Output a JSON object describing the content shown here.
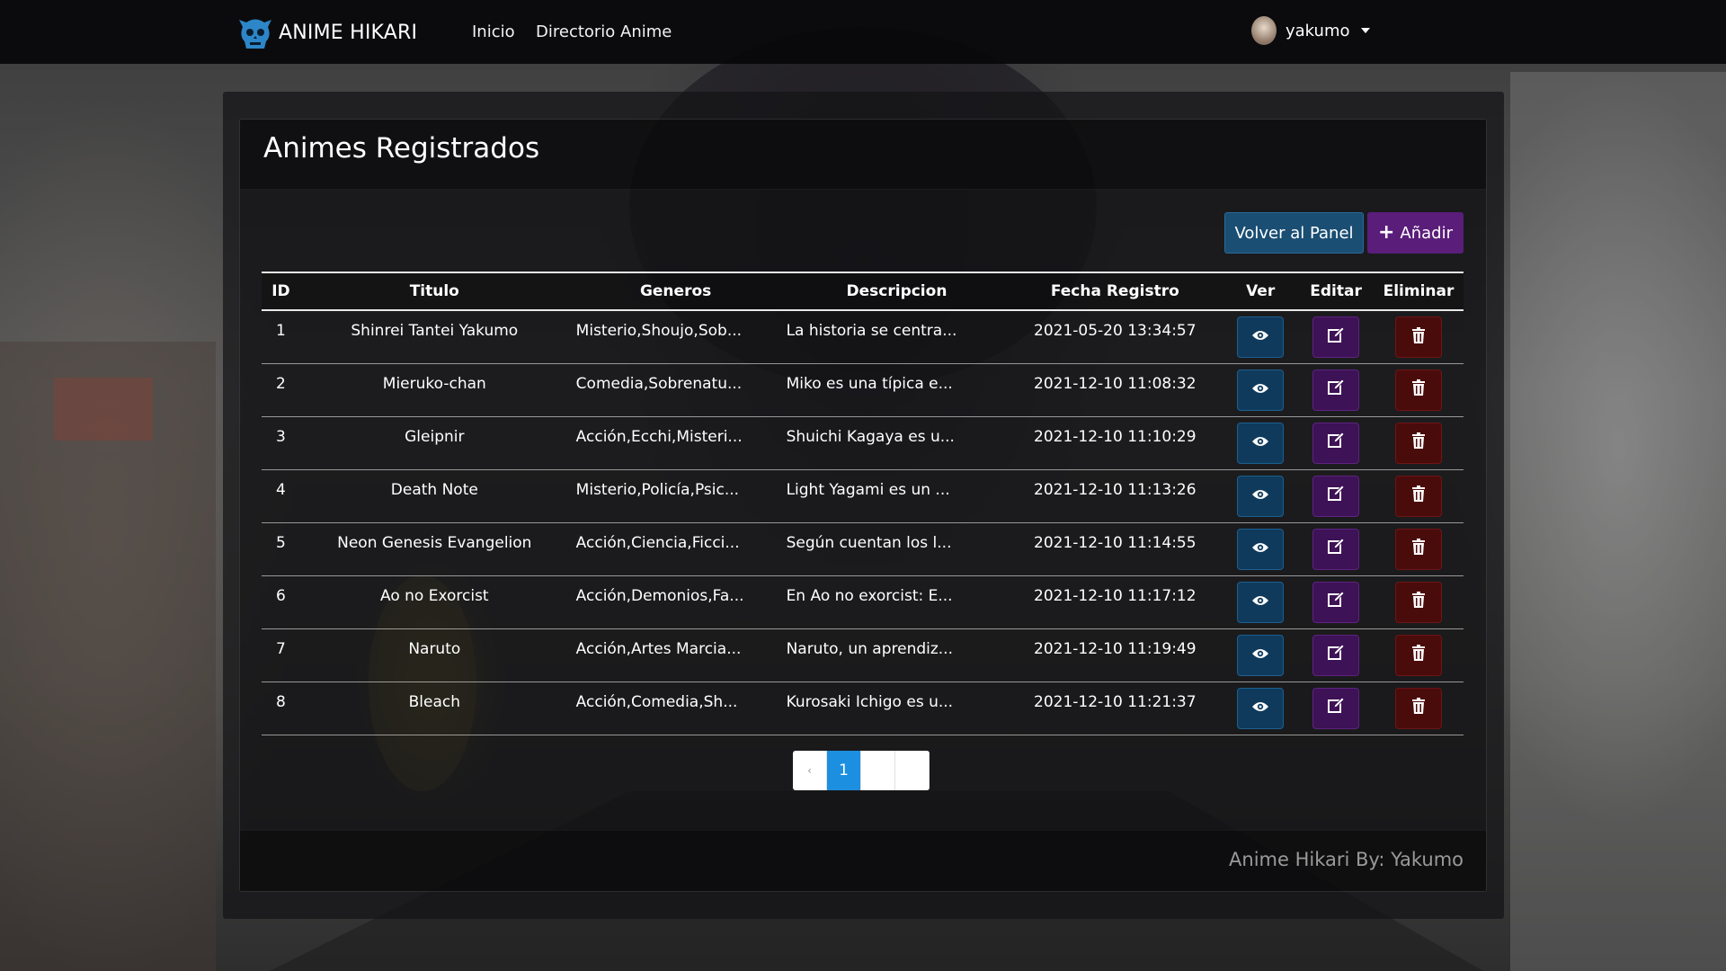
{
  "nav": {
    "brand": "ANIME HIKARI",
    "links": [
      "Inicio",
      "Directorio Anime"
    ],
    "user": "yakumo"
  },
  "card": {
    "title": "Animes Registrados",
    "back_button": "Volver al Panel",
    "add_button": "Añadir",
    "footer": "Anime Hikari By: Yakumo"
  },
  "table": {
    "headers": [
      "ID",
      "Titulo",
      "Generos",
      "Descripcion",
      "Fecha Registro",
      "Ver",
      "Editar",
      "Eliminar"
    ],
    "rows": [
      {
        "id": "1",
        "title": "Shinrei Tantei Yakumo",
        "genres": "Misterio,Shoujo,Sob...",
        "desc": "La historia se centra...",
        "date": "2021-05-20 13:34:57"
      },
      {
        "id": "2",
        "title": "Mieruko-chan",
        "genres": "Comedia,Sobrenatu...",
        "desc": "Miko es una típica e...",
        "date": "2021-12-10 11:08:32"
      },
      {
        "id": "3",
        "title": "Gleipnir",
        "genres": "Acción,Ecchi,Misteri...",
        "desc": "Shuichi Kagaya es u...",
        "date": "2021-12-10 11:10:29"
      },
      {
        "id": "4",
        "title": "Death Note",
        "genres": "Misterio,Policía,Psic...",
        "desc": "Light Yagami es un ...",
        "date": "2021-12-10 11:13:26"
      },
      {
        "id": "5",
        "title": "Neon Genesis Evangelion",
        "genres": "Acción,Ciencia,Ficci...",
        "desc": "Según cuentan los l...",
        "date": "2021-12-10 11:14:55"
      },
      {
        "id": "6",
        "title": "Ao no Exorcist",
        "genres": "Acción,Demonios,Fa...",
        "desc": "En Ao no exorcist: E...",
        "date": "2021-12-10 11:17:12"
      },
      {
        "id": "7",
        "title": "Naruto",
        "genres": "Acción,Artes Marcia...",
        "desc": "Naruto, un aprendiz...",
        "date": "2021-12-10 11:19:49"
      },
      {
        "id": "8",
        "title": "Bleach",
        "genres": "Acción,Comedia,Sh...",
        "desc": "Kurosaki Ichigo es u...",
        "date": "2021-12-10 11:21:37"
      }
    ]
  },
  "pagination": {
    "prev": "‹",
    "pages": [
      "1",
      "",
      ""
    ],
    "active": "1"
  },
  "colors": {
    "view_button": "#0f3a5c",
    "edit_button": "#3e1256",
    "delete_button": "#4a0b0b",
    "back_button": "#1a4e73",
    "add_button": "#5a1d7a",
    "active_page": "#1d8fe0"
  },
  "icons": {
    "brand": "skull-logo-icon",
    "view": "eye-icon",
    "edit": "edit-icon",
    "delete": "trash-icon",
    "add": "plus-icon",
    "user_menu": "caret-down-icon"
  }
}
